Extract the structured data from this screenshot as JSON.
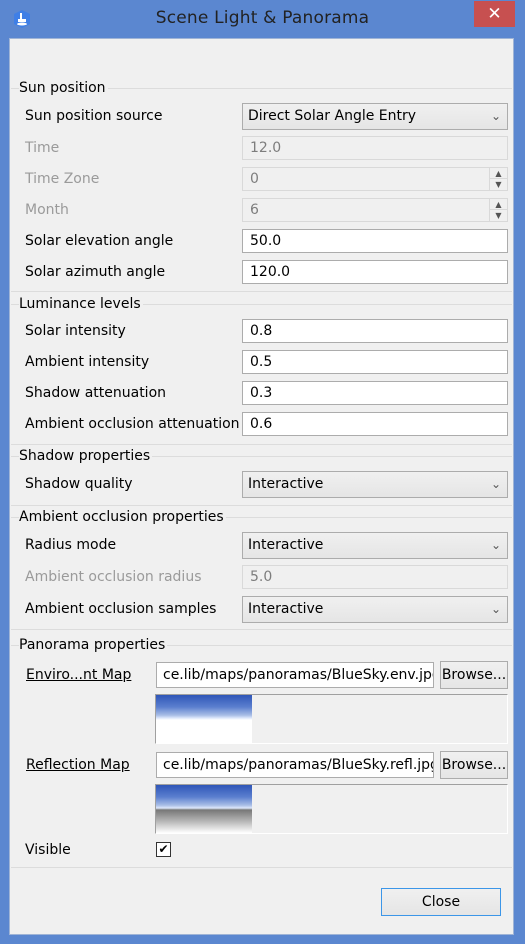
{
  "window": {
    "title": "Scene Light & Panorama",
    "close_glyph": "✕",
    "app_icon": "app-logo-icon"
  },
  "sun_position": {
    "title": "Sun position",
    "source": {
      "label": "Sun position source",
      "value": "Direct Solar Angle Entry"
    },
    "time": {
      "label": "Time",
      "value": "12.0"
    },
    "time_zone": {
      "label": "Time Zone",
      "value": "0"
    },
    "month": {
      "label": "Month",
      "value": "6"
    },
    "elevation": {
      "label": "Solar elevation angle",
      "value": "50.0"
    },
    "azimuth": {
      "label": "Solar azimuth angle",
      "value": "120.0"
    }
  },
  "luminance": {
    "title": "Luminance levels",
    "solar_intensity": {
      "label": "Solar intensity",
      "value": "0.8"
    },
    "ambient_intensity": {
      "label": "Ambient intensity",
      "value": "0.5"
    },
    "shadow_attenuation": {
      "label": "Shadow attenuation",
      "value": "0.3"
    },
    "ao_attenuation": {
      "label": "Ambient occlusion attenuation",
      "value": "0.6"
    }
  },
  "shadow": {
    "title": "Shadow properties",
    "quality": {
      "label": "Shadow quality",
      "value": "Interactive"
    }
  },
  "ambient_occlusion": {
    "title": "Ambient occlusion properties",
    "radius_mode": {
      "label": "Radius mode",
      "value": "Interactive"
    },
    "radius": {
      "label": "Ambient occlusion radius",
      "value": "5.0"
    },
    "samples": {
      "label": "Ambient occlusion samples",
      "value": "Interactive"
    }
  },
  "panorama": {
    "title": "Panorama properties",
    "environment_map": {
      "label": "Enviro...nt Map",
      "path": "ce.lib/maps/panoramas/BlueSky.env.jpg",
      "browse": "Browse..."
    },
    "reflection_map": {
      "label": "Reflection Map",
      "path": "ce.lib/maps/panoramas/BlueSky.refl.jpg",
      "browse": "Browse..."
    },
    "visible": {
      "label": "Visible",
      "checked": true,
      "check_glyph": "✔"
    }
  },
  "footer": {
    "close_label": "Close"
  },
  "icons": {
    "chevron": "⌄",
    "spin_up": "▲",
    "spin_down": "▼"
  },
  "colors": {
    "titlebar": "#5b87d0",
    "close_button": "#c75050",
    "focus_border": "#3c96e8"
  }
}
